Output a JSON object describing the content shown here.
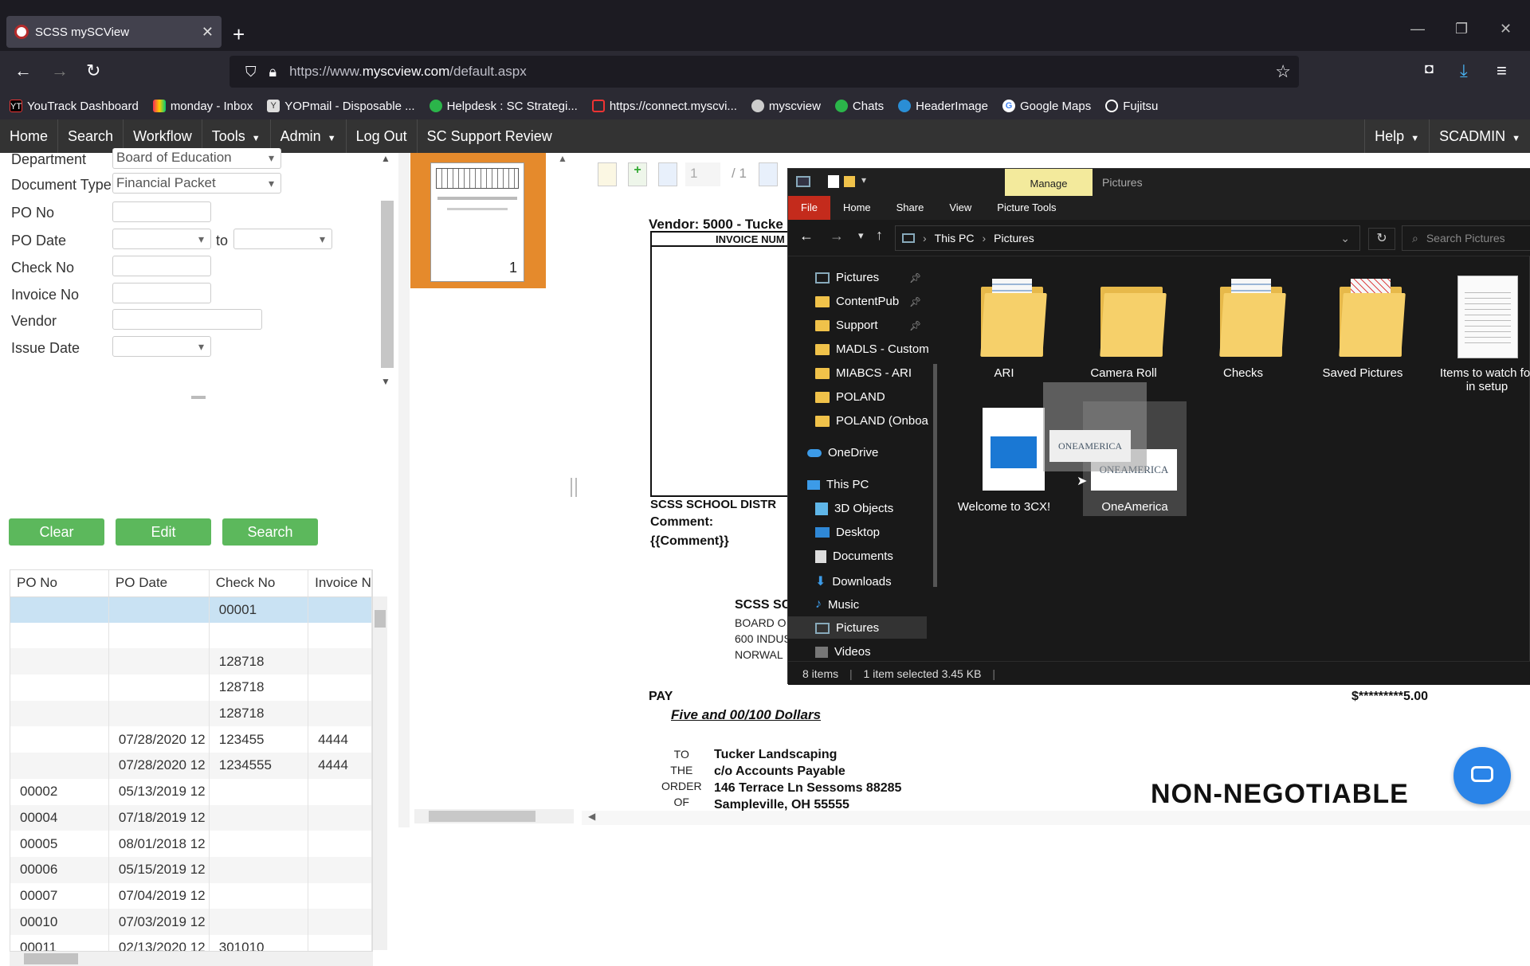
{
  "browser": {
    "tab_title": "SCSS mySCView",
    "url_prefix": "https://www.",
    "url_domain": "myscview.com",
    "url_path": "/default.aspx",
    "bookmarks": [
      "YouTrack Dashboard",
      "monday - Inbox",
      "YOPmail - Disposable ...",
      "Helpdesk : SC Strategi...",
      "https://connect.myscvi...",
      "myscview",
      "Chats",
      "HeaderImage",
      "Google Maps",
      "Fujitsu"
    ]
  },
  "app_menu": {
    "items": [
      "Home",
      "Search",
      "Workflow",
      "Tools",
      "Admin",
      "Log Out",
      "SC Support Review"
    ],
    "help": "Help",
    "user": "SCADMIN"
  },
  "search_form": {
    "department_label": "Department",
    "department_value": "Board of Education",
    "doc_type_label": "Document Type",
    "doc_type_value": "Financial Packet",
    "po_no_label": "PO No",
    "po_date_label": "PO Date",
    "to_label": "to",
    "check_no_label": "Check No",
    "invoice_no_label": "Invoice No",
    "vendor_label": "Vendor",
    "issue_date_label": "Issue Date",
    "clear_label": "Clear",
    "edit_label": "Edit",
    "search_label": "Search"
  },
  "grid": {
    "headers": [
      "PO No",
      "PO Date",
      "Check No",
      "Invoice N"
    ],
    "rows": [
      [
        "",
        "",
        "00001",
        ""
      ],
      [
        "",
        "",
        "",
        ""
      ],
      [
        "",
        "",
        "128718",
        ""
      ],
      [
        "",
        "",
        "128718",
        ""
      ],
      [
        "",
        "",
        "128718",
        ""
      ],
      [
        "",
        "07/28/2020 12",
        "123455",
        "4444"
      ],
      [
        "",
        "07/28/2020 12",
        "1234555",
        "4444"
      ],
      [
        "00002",
        "05/13/2019 12",
        "",
        ""
      ],
      [
        "00004",
        "07/18/2019 12",
        "",
        ""
      ],
      [
        "00005",
        "08/01/2018 12",
        "",
        ""
      ],
      [
        "00006",
        "05/15/2019 12",
        "",
        ""
      ],
      [
        "00007",
        "07/04/2019 12",
        "",
        ""
      ],
      [
        "00010",
        "07/03/2019 12",
        "",
        ""
      ],
      [
        "00011",
        "02/13/2020 12",
        "301010",
        ""
      ]
    ]
  },
  "thumbnail": {
    "page_number": "1"
  },
  "viewer": {
    "page_input": "1",
    "page_total": "/ 1"
  },
  "document": {
    "vendor_line": "Vendor:  5000 - Tucke",
    "invoice_header": "INVOICE NUM",
    "school_district": "SCSS SCHOOL DISTR",
    "comment_label": "Comment:",
    "comment_value": "{{Comment}}",
    "addr_title": "SCSS SC",
    "addr_line1": "BOARD O",
    "addr_line2": "600 INDUS",
    "addr_line3": "NORWAL",
    "pay_label": "PAY",
    "amount_words": "Five and 00/100 Dollars",
    "amount": "$*********5.00",
    "to_the_order_of": [
      "TO",
      "THE",
      "ORDER",
      "OF"
    ],
    "payee": [
      "Tucker Landscaping",
      "c/o Accounts Payable",
      "146 Terrace Ln Sessoms 88285",
      "Sampleville, OH 55555"
    ],
    "non_negotiable": "NON-NEGOTIABLE"
  },
  "explorer": {
    "manage_tab": "Manage",
    "window_title": "Pictures",
    "ribbon": [
      "File",
      "Home",
      "Share",
      "View",
      "Picture Tools"
    ],
    "path": [
      "This PC",
      "Pictures"
    ],
    "search_placeholder": "Search Pictures",
    "nav_items": {
      "quick": [
        "Pictures",
        "ContentPub",
        "Support",
        "MADLS - Custom",
        "MIABCS - ARI",
        "POLAND",
        "POLAND (Onboa"
      ],
      "onedrive": "OneDrive",
      "this_pc": "This PC",
      "pc_items": [
        "3D Objects",
        "Desktop",
        "Documents",
        "Downloads",
        "Music",
        "Pictures",
        "Videos"
      ]
    },
    "items": [
      "ARI",
      "Camera Roll",
      "Checks",
      "Saved Pictures",
      "Items to watch for in setup",
      "Welcome to 3CX!",
      "OneAmerica"
    ],
    "status_count": "8 items",
    "status_selected": "1 item selected  3.45 KB",
    "drag_logo_text": "ONEAMERICA"
  }
}
